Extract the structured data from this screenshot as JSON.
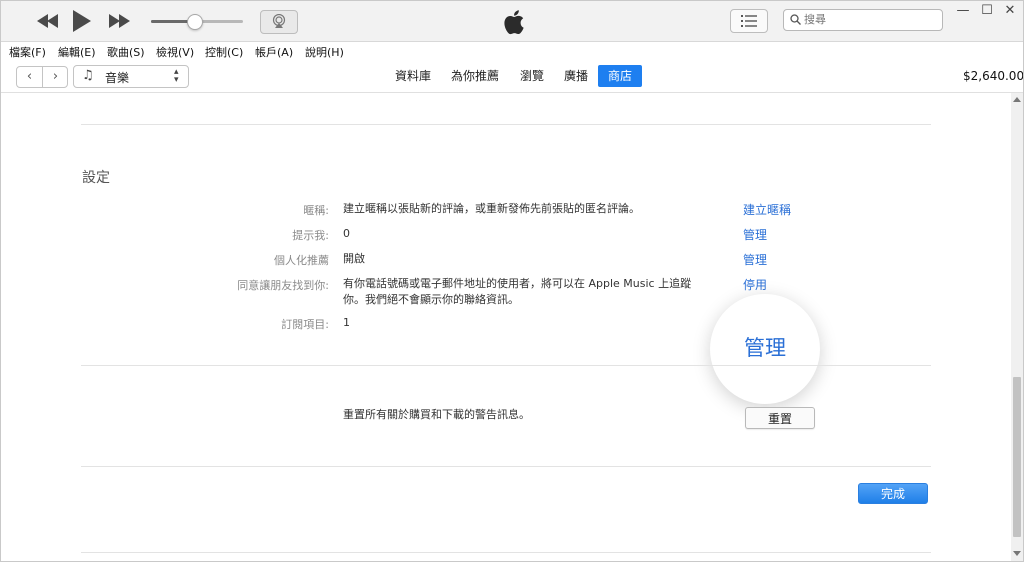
{
  "toolbar": {
    "volume_level": 0.47,
    "search_placeholder": "搜尋",
    "window_controls": [
      "—",
      "☐",
      "✕"
    ]
  },
  "menu": [
    "檔案(F)",
    "編輯(E)",
    "歌曲(S)",
    "檢視(V)",
    "控制(C)",
    "帳戶(A)",
    "說明(H)"
  ],
  "nav": {
    "back": "‹",
    "forward": "›",
    "media_icon": "music-note-icon",
    "media_label": "音樂",
    "tabs": [
      "資料庫",
      "為你推薦",
      "瀏覽",
      "廣播",
      "商店"
    ],
    "active_tab": "商店",
    "balance": "$2,640.00"
  },
  "settings": {
    "title": "設定",
    "rows": [
      {
        "label": "暱稱:",
        "value": "建立暱稱以張貼新的評論，或重新發佈先前張貼的匿名評論。",
        "action": "建立暱稱"
      },
      {
        "label": "提示我:",
        "value": "0",
        "action": "管理"
      },
      {
        "label": "個人化推薦",
        "value": "開啟",
        "action": "管理"
      },
      {
        "label": "同意讓朋友找到你:",
        "value_line1": "有你電話號碼或電子郵件地址的使用者，將可以在 Apple Music 上追蹤",
        "value_line2": "你。我們絕不會顯示你的聯絡資訊。",
        "action": "停用"
      },
      {
        "label": "訂閱項目:",
        "value": "1"
      }
    ],
    "magnified_label": "管理",
    "reset_text": "重置所有關於購買和下載的警告訊息。",
    "reset_button": "重置",
    "done_button": "完成"
  }
}
